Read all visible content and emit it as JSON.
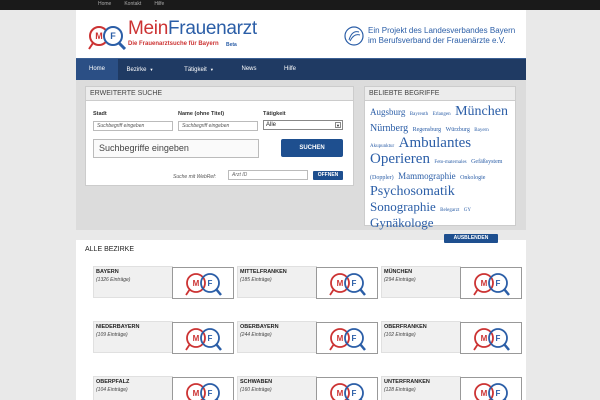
{
  "topbar": {
    "links": [
      "Home",
      "Kontakt",
      "Hilfe"
    ]
  },
  "header": {
    "brand": {
      "mein": "Mein",
      "frauenarzt": "Frauenarzt",
      "subtitle": "Die Frauenarztsuche für Bayern",
      "beta": "Beta",
      "badge_letters": [
        "M",
        "F"
      ]
    },
    "project_line1": "Ein Projekt des Landesverbandes Bayern",
    "project_line2": "im Berufsverband der Frauenärzte e.V."
  },
  "nav": {
    "home": "Home",
    "bezirke": "Bezirke",
    "taetigkeit": "Tätigkeit",
    "news": "News",
    "hilfe": "Hilfe"
  },
  "search": {
    "panel_title": "ERWEITERTE SUCHE",
    "stadt_label": "Stadt",
    "stadt_placeholder": "Suchbegriff eingeben",
    "name_label": "Name (ohne Titel)",
    "name_placeholder": "Suchbegriff eingeben",
    "taetigkeit_label": "Tätigkeit",
    "taetigkeit_value": "Alle",
    "main_placeholder": "Suchbegriffe eingeben",
    "submit_label": "SUCHEN",
    "webref_label": "Suche mit WebRef:",
    "webref_placeholder": "Arzt ID",
    "open_label": "OFFNEN"
  },
  "tags": {
    "panel_title": "BELIEBTE BEGRIFFE",
    "items": [
      {
        "text": "Augsburg",
        "size": 9
      },
      {
        "text": "Bayreuth",
        "size": 5
      },
      {
        "text": "Erlangen",
        "size": 5
      },
      {
        "text": "München",
        "size": 14
      },
      {
        "text": "Nürnberg",
        "size": 10
      },
      {
        "text": "Regensburg",
        "size": 6
      },
      {
        "text": "Würzburg",
        "size": 6
      },
      {
        "text": "Bayern",
        "size": 5
      },
      {
        "text": "Akupunktur",
        "size": 5
      },
      {
        "text": "Ambulantes Operieren",
        "size": 15
      },
      {
        "text": "Feto-maternales",
        "size": 5
      },
      {
        "text": "Gefäßsystem (Doppler)",
        "size": 6
      },
      {
        "text": "Mammographie",
        "size": 9
      },
      {
        "text": "Onkologie",
        "size": 6
      },
      {
        "text": "Psychosomatik",
        "size": 14
      },
      {
        "text": "Sonographie",
        "size": 13
      },
      {
        "text": "Belegarzt",
        "size": 5
      },
      {
        "text": "GY",
        "size": 5
      },
      {
        "text": "Gynäkologe",
        "size": 13
      }
    ]
  },
  "bezirke": {
    "title": "ALLE BEZIRKE",
    "toggle_label": "AUSBLENDEN",
    "items": [
      {
        "name": "BAYERN",
        "count": "(1326 Einträge)"
      },
      {
        "name": "MITTELFRANKEN",
        "count": "(185 Einträge)"
      },
      {
        "name": "MÜNCHEN",
        "count": "(294 Einträge)"
      },
      {
        "name": "NIEDERBAYERN",
        "count": "(109 Einträge)"
      },
      {
        "name": "OBERBAYERN",
        "count": "(244 Einträge)"
      },
      {
        "name": "OBERFRANKEN",
        "count": "(102 Einträge)"
      },
      {
        "name": "OBERPFALZ",
        "count": "(104 Einträge)"
      },
      {
        "name": "SCHWABEN",
        "count": "(160 Einträge)"
      },
      {
        "name": "UNTERFRANKEN",
        "count": "(128 Einträge)"
      }
    ]
  }
}
